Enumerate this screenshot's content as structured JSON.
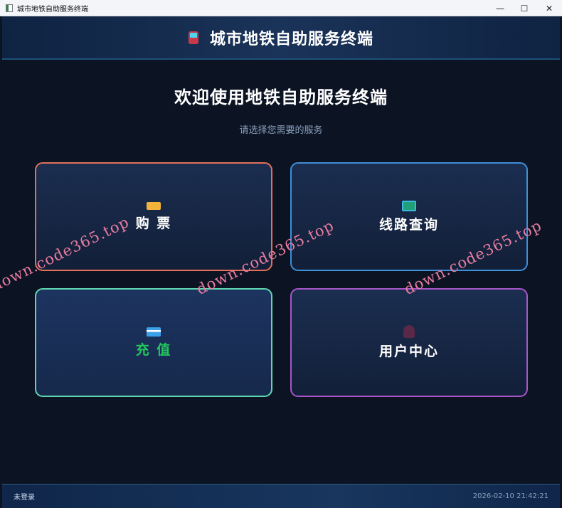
{
  "window": {
    "title": "城市地铁自助服务终端",
    "minimize": "—",
    "maximize": "☐",
    "close": "✕"
  },
  "header": {
    "title": "城市地铁自助服务终端",
    "icon": "metro-train-icon"
  },
  "main": {
    "welcome": "欢迎使用地铁自助服务终端",
    "subtitle": "请选择您需要的服务",
    "cards": [
      {
        "label": "购 票",
        "icon": "ticket-icon",
        "border": "#e0705a",
        "text": "#ffffff"
      },
      {
        "label": "线路查询",
        "icon": "map-icon",
        "border": "#3d8fd8",
        "text": "#ffffff"
      },
      {
        "label": "充 值",
        "icon": "credit-card-icon",
        "border": "#5fd8b0",
        "text": "#22c55e"
      },
      {
        "label": "用户中心",
        "icon": "user-icon",
        "border": "#a855c8",
        "text": "#ffffff"
      }
    ]
  },
  "footer": {
    "login_status": "未登录",
    "datetime": "2026-02-10 21:42:21"
  },
  "watermark": "down.code365.top"
}
